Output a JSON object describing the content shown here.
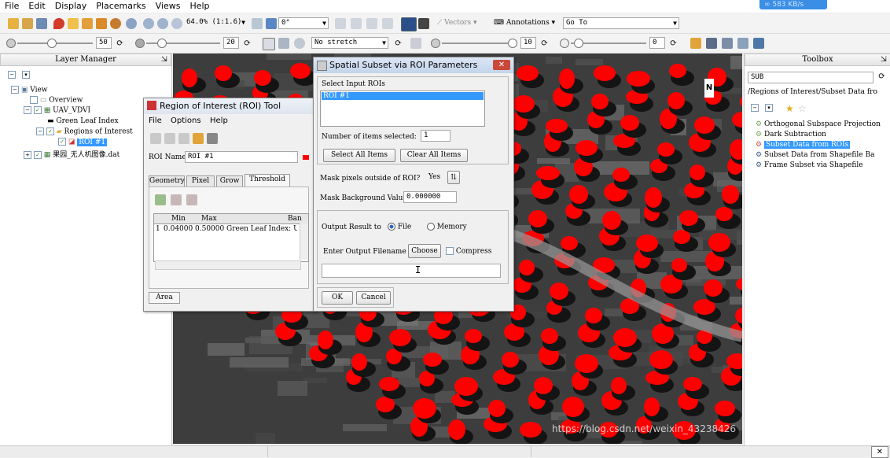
{
  "menubar": {
    "items": [
      "File",
      "Edit",
      "Display",
      "Placemarks",
      "Views",
      "Help"
    ]
  },
  "network_speed": "583 KB/s",
  "toolbar1": {
    "zoom_value": "64.0% (1:1.6)",
    "rotation_value": "0°",
    "vectors_label": "Vectors",
    "annotations_label": "Annotations",
    "goto_label": "Go To"
  },
  "toolbar2": {
    "brightness_value": "50",
    "contrast_value": "20",
    "stretch_value": "No stretch",
    "sharpen_value": "10",
    "transparency_value": "0"
  },
  "layer_manager": {
    "title": "Layer Manager",
    "items": [
      {
        "label": "View"
      },
      {
        "label": "Overview"
      },
      {
        "label": "UAV_VDVI"
      },
      {
        "label": "Green Leaf Index"
      },
      {
        "label": "Regions of Interest"
      },
      {
        "label": "ROI #1"
      },
      {
        "label": "果园_无人机图像.dat"
      }
    ]
  },
  "toolbox": {
    "title": "Toolbox",
    "search_value": "SUB",
    "path": "/Regions of Interest/Subset Data fro",
    "items": [
      {
        "label": "Orthogonal Subspace Projection"
      },
      {
        "label": "Dark Subtraction"
      },
      {
        "label": "Subset Data from ROIs"
      },
      {
        "label": "Subset Data from Shapefile Ba"
      },
      {
        "label": "Frame Subset via Shapefile"
      }
    ]
  },
  "roi_tool": {
    "title": "Region of Interest (ROI) Tool",
    "menu": [
      "File",
      "Options",
      "Help"
    ],
    "roi_name_label": "ROI Name:",
    "roi_name_value": "ROI #1",
    "tabs": [
      "Geometry",
      "Pixel",
      "Grow",
      "Threshold"
    ],
    "table_headers": [
      "Min",
      "Max",
      "Ban"
    ],
    "table_row": {
      "index": "1",
      "min": "0.04000",
      "max": "0.50000",
      "band": "Green Leaf Index: U"
    },
    "area_tab": "Area"
  },
  "subset_dialog": {
    "title": "Spatial Subset via ROI Parameters",
    "select_label": "Select Input ROIs",
    "roi_list": [
      "ROI #1"
    ],
    "num_selected_label": "Number of items selected:",
    "num_selected_value": "1",
    "select_all": "Select All Items",
    "clear_all": "Clear All Items",
    "mask_label": "Mask pixels outside of ROI?",
    "mask_value": "Yes",
    "mask_bg_label": "Mask Background Value",
    "mask_bg_value": "0.000000",
    "output_label": "Output Result to",
    "output_file": "File",
    "output_memory": "Memory",
    "filename_label": "Enter Output Filename",
    "choose": "Choose",
    "compress": "Compress",
    "filename_value": "",
    "ok": "OK",
    "cancel": "Cancel"
  },
  "watermark": "https://blog.csdn.net/weixin_43238426",
  "colors": {
    "roi_red": "#ff0000",
    "selection_blue": "#3399ff",
    "title_blue": "#c8d8ee"
  }
}
